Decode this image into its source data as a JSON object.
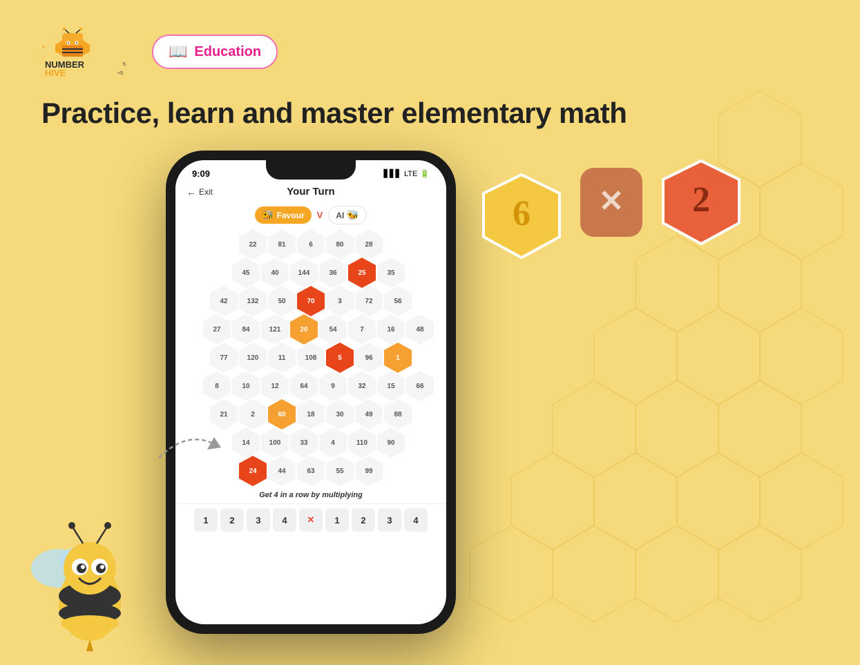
{
  "logo": {
    "text": "NUMBER HIVE",
    "alt": "Number Hive Logo"
  },
  "badge": {
    "icon": "📖",
    "label": "Education"
  },
  "tagline": "Practice, learn and master  elementary math",
  "phone": {
    "time": "9:09",
    "signal": "▋▋▋ LTE 🔋",
    "turn_label": "Your Turn",
    "back_label": "Exit",
    "player1": "Favour",
    "player2": "AI",
    "vs": "V",
    "instruction": "Get 4 in a row by multiplying",
    "rows": [
      [
        "22",
        "81",
        "6",
        "80",
        "28"
      ],
      [
        "45",
        "40",
        "144",
        "36",
        "25",
        "35"
      ],
      [
        "42",
        "132",
        "50",
        "70",
        "3",
        "72",
        "56"
      ],
      [
        "27",
        "84",
        "121",
        "20",
        "54",
        "7",
        "16",
        "48"
      ],
      [
        "77",
        "120",
        "11",
        "108",
        "5",
        "96",
        "1"
      ],
      [
        "8",
        "10",
        "12",
        "64",
        "9",
        "32",
        "15",
        "66"
      ],
      [
        "21",
        "2",
        "60",
        "18",
        "30",
        "49",
        "88"
      ],
      [
        "14",
        "100",
        "33",
        "4",
        "110",
        "90"
      ],
      [
        "24",
        "44",
        "63",
        "55",
        "99"
      ]
    ],
    "row_colors": [
      [
        "",
        "",
        "",
        "",
        ""
      ],
      [
        "",
        "",
        "",
        "",
        "orange-dark",
        ""
      ],
      [
        "",
        "",
        "",
        "orange-dark",
        "",
        "",
        ""
      ],
      [
        "",
        "",
        "",
        "orange-light",
        "",
        "",
        "",
        ""
      ],
      [
        "",
        "",
        "",
        "",
        "orange-dark",
        "",
        "orange-light"
      ],
      [
        "",
        "",
        "",
        "",
        "",
        "",
        "",
        ""
      ],
      [
        "",
        "",
        "orange-light",
        "",
        "",
        "",
        ""
      ],
      [
        "",
        "",
        "",
        "",
        "",
        ""
      ],
      [
        "orange-dark",
        "",
        "",
        "",
        ""
      ]
    ],
    "bottom_numbers": [
      "1",
      "2",
      "3",
      "4",
      "✕",
      "1",
      "2",
      "3",
      "4"
    ]
  },
  "float_hex_6": {
    "value": "6",
    "color": "#f5c842"
  },
  "float_hex_x": {
    "value": "✕",
    "color": "#d4845a"
  },
  "float_hex_2": {
    "value": "2",
    "color": "#e8613a"
  }
}
